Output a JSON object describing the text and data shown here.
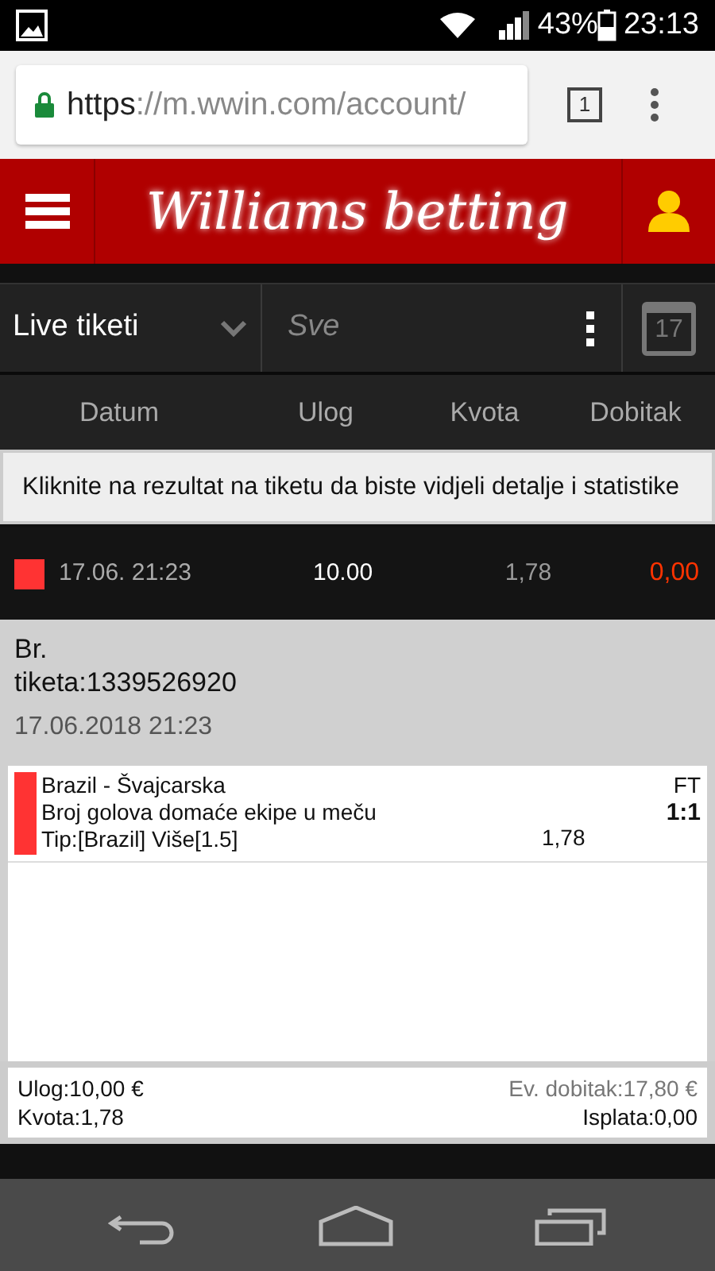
{
  "status_bar": {
    "battery": "43%",
    "time": "23:13"
  },
  "browser": {
    "url_scheme": "https",
    "url_rest": "://m.wwin.com/account/",
    "tab_count": "1"
  },
  "header": {
    "logo": "Williams betting"
  },
  "filter": {
    "type": "Live tiketi",
    "status": "Sve",
    "calendar_day": "17"
  },
  "columns": [
    "Datum",
    "Ulog",
    "Kvota",
    "Dobitak"
  ],
  "notice": "Kliknite na rezultat na tiketu da biste vidjeli detalje i statistike",
  "ticket": {
    "color": "#ff3333",
    "date": "17.06. 21:23",
    "stake": "10.00",
    "odds": "1,78",
    "win": "0,00"
  },
  "detail": {
    "number_label": "Br.",
    "number": "tiketa:1339526920",
    "datetime": "17.06.2018 21:23",
    "events": [
      {
        "color": "#ff3333",
        "match": "Brazil - Švajcarska",
        "market": "Broj golova domaće ekipe u meču",
        "tip": "Tip:[Brazil] Više[1.5]",
        "odds": "1,78",
        "status": "FT",
        "score": "1:1"
      }
    ],
    "summary": {
      "stake": "Ulog:10,00 €",
      "odds": "Kvota:1,78",
      "potential": "Ev. dobitak:17,80 €",
      "payout": "Isplata:0,00"
    }
  }
}
